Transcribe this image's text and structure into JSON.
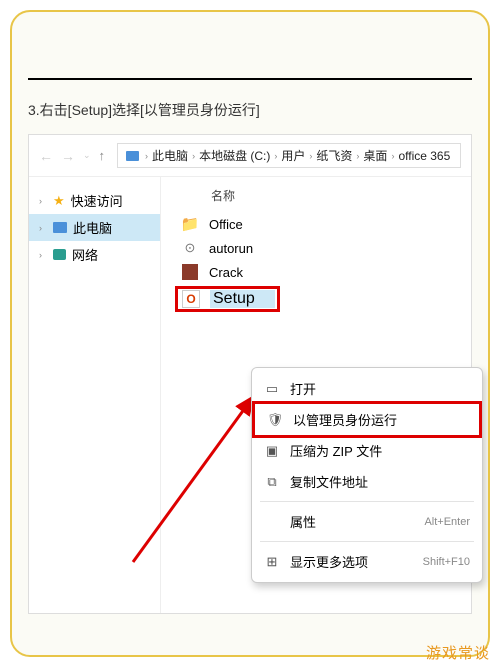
{
  "instruction": "3.右击[Setup]选择[以管理员身份运行]",
  "breadcrumb": [
    "此电脑",
    "本地磁盘 (C:)",
    "用户",
    "纸飞资",
    "桌面",
    "office 365"
  ],
  "sidebar": {
    "items": [
      {
        "label": "快速访问"
      },
      {
        "label": "此电脑"
      },
      {
        "label": "网络"
      }
    ]
  },
  "column_header": "名称",
  "files": [
    {
      "label": "Office"
    },
    {
      "label": "autorun"
    },
    {
      "label": "Crack"
    },
    {
      "label": "Setup"
    }
  ],
  "context_menu": {
    "items": [
      {
        "label": "打开",
        "shortcut": ""
      },
      {
        "label": "以管理员身份运行",
        "shortcut": ""
      },
      {
        "label": "压缩为 ZIP 文件",
        "shortcut": ""
      },
      {
        "label": "复制文件地址",
        "shortcut": ""
      },
      {
        "label": "属性",
        "shortcut": "Alt+Enter"
      },
      {
        "label": "显示更多选项",
        "shortcut": "Shift+F10"
      }
    ]
  },
  "watermark": "游戏常谈"
}
